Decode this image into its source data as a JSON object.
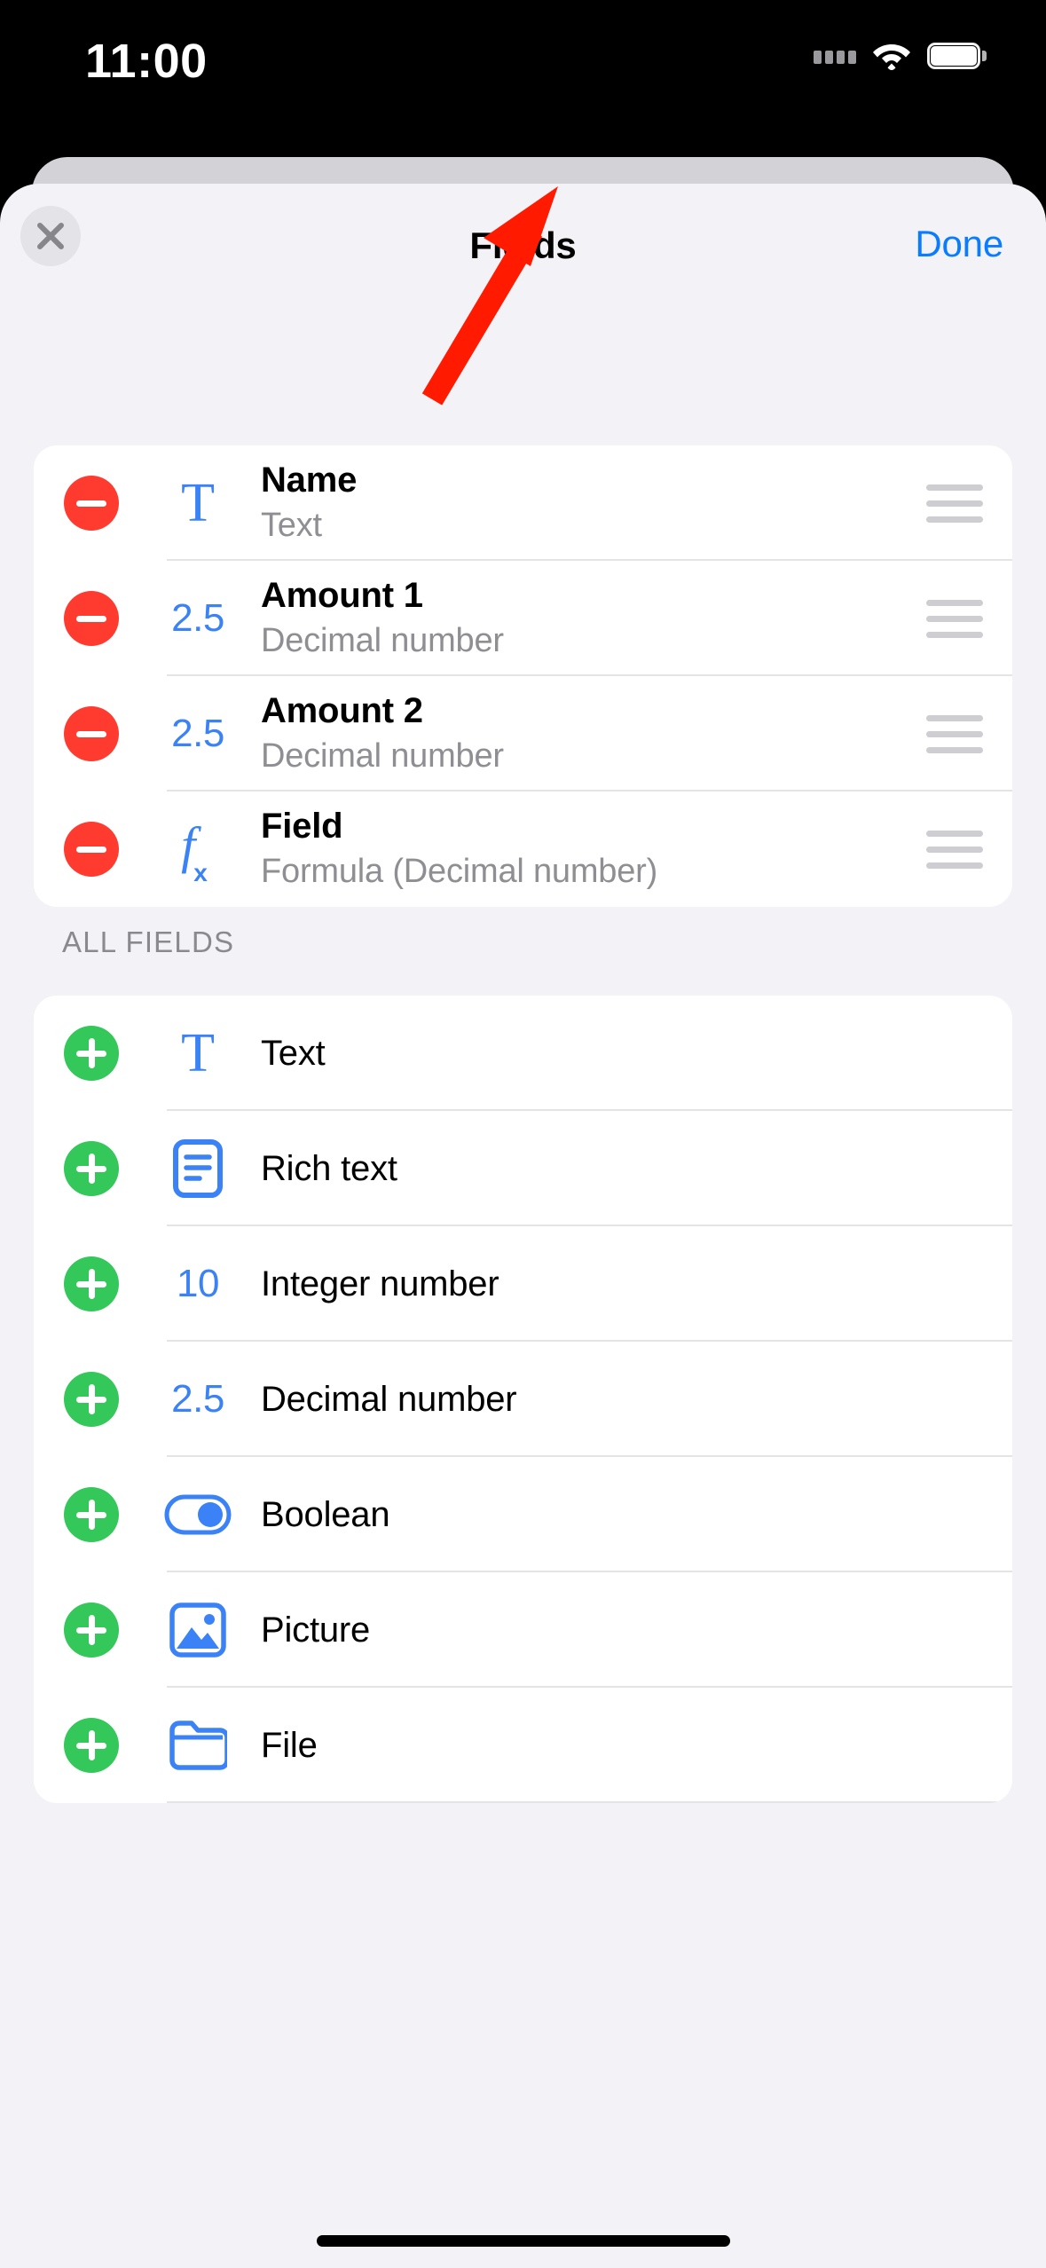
{
  "status_bar": {
    "time": "11:00",
    "signal_icon": "signal-dots-icon",
    "wifi_icon": "wifi-icon",
    "battery_icon": "battery-full-icon"
  },
  "nav": {
    "close_icon": "close-x-icon",
    "title": "Fields",
    "done_label": "Done"
  },
  "selected_fields": [
    {
      "action_icon": "remove-minus-icon",
      "type_icon": "text-T-icon",
      "type_glyph": "T",
      "name": "Name",
      "type_label": "Text",
      "drag_icon": "drag-handle-icon"
    },
    {
      "action_icon": "remove-minus-icon",
      "type_icon": "decimal-25-icon",
      "type_glyph": "2.5",
      "name": "Amount 1",
      "type_label": "Decimal number",
      "drag_icon": "drag-handle-icon"
    },
    {
      "action_icon": "remove-minus-icon",
      "type_icon": "decimal-25-icon",
      "type_glyph": "2.5",
      "name": "Amount 2",
      "type_label": "Decimal number",
      "drag_icon": "drag-handle-icon"
    },
    {
      "action_icon": "remove-minus-icon",
      "type_icon": "formula-fx-icon",
      "type_glyph": "fx",
      "name": "Field",
      "type_label": "Formula (Decimal number)",
      "drag_icon": "drag-handle-icon"
    }
  ],
  "all_fields": {
    "section_label": "ALL FIELDS",
    "items": [
      {
        "action_icon": "add-plus-icon",
        "type_icon": "text-T-icon",
        "type_glyph": "T",
        "label": "Text"
      },
      {
        "action_icon": "add-plus-icon",
        "type_icon": "rich-text-icon",
        "type_glyph": "",
        "label": "Rich text"
      },
      {
        "action_icon": "add-plus-icon",
        "type_icon": "integer-10-icon",
        "type_glyph": "10",
        "label": "Integer number"
      },
      {
        "action_icon": "add-plus-icon",
        "type_icon": "decimal-25-icon",
        "type_glyph": "2.5",
        "label": "Decimal number"
      },
      {
        "action_icon": "add-plus-icon",
        "type_icon": "toggle-icon",
        "type_glyph": "",
        "label": "Boolean"
      },
      {
        "action_icon": "add-plus-icon",
        "type_icon": "picture-icon",
        "type_glyph": "",
        "label": "Picture"
      },
      {
        "action_icon": "add-plus-icon",
        "type_icon": "folder-icon",
        "type_glyph": "",
        "label": "File"
      }
    ]
  },
  "annotation": {
    "arrow_icon": "red-pointer-arrow",
    "arrow_color": "#ff1a00",
    "points_to": "Done"
  },
  "colors": {
    "accent_blue": "#0a7cff",
    "icon_blue": "#3b82f6",
    "remove_red": "#ff3b30",
    "add_green": "#34c759",
    "sheet_bg": "#f2f2f7",
    "card_bg": "#ffffff",
    "subtitle_gray": "#8e8e93"
  }
}
